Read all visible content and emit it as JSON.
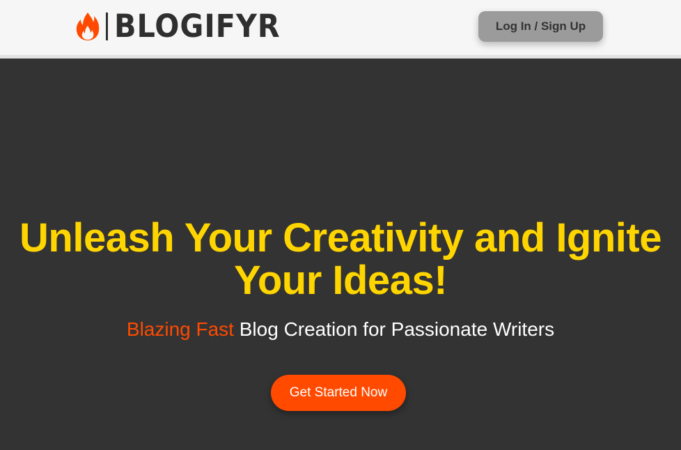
{
  "header": {
    "logo_text": "BLOGIFYR",
    "logo_icon": "flame-icon",
    "login_label": "Log In / Sign Up"
  },
  "hero": {
    "title": "Unleash Your Creativity and Ignite Your Ideas!",
    "subtitle_accent": "Blazing Fast",
    "subtitle_rest": " Blog Creation for Passionate Writers",
    "cta_label": "Get Started Now"
  },
  "colors": {
    "header_bg": "#f6f6f6",
    "hero_bg": "#333333",
    "title": "#ffd500",
    "accent": "#ff4a00",
    "login_bg": "#9b9b9b",
    "logo_text": "#2f2f2f"
  }
}
